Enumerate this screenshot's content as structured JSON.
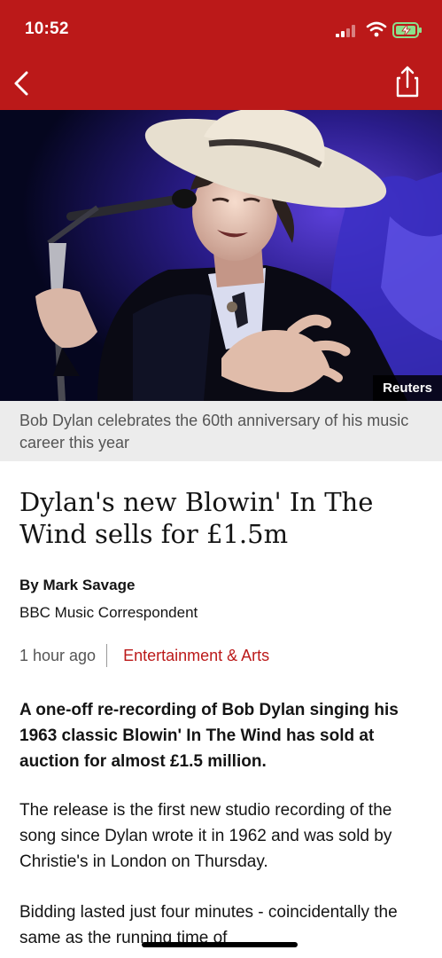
{
  "status_bar": {
    "time": "10:52",
    "signal_icon": "signal-icon",
    "wifi_icon": "wifi-icon",
    "battery_icon": "battery-charging-icon"
  },
  "header": {
    "back_icon": "chevron-left-icon",
    "share_icon": "share-icon",
    "background_color": "#bb1919"
  },
  "hero": {
    "credit": "Reuters",
    "caption": "Bob Dylan celebrates the 60th anniversary of his music career this year"
  },
  "article": {
    "headline": "Dylan's new Blowin' In The Wind sells for £1.5m",
    "author": "By Mark Savage",
    "role": "BBC Music Correspondent",
    "time": "1 hour ago",
    "topic": "Entertainment & Arts",
    "lead": "A one-off re-recording of Bob Dylan singing his 1963 classic Blowin' In The Wind has sold at auction for almost £1.5 million.",
    "paragraph_2": "The release is the first new studio recording of the song since Dylan wrote it in 1962 and was sold by Christie's in London on Thursday.",
    "paragraph_3": "Bidding lasted just four minutes - coincidentally the same as the running time of"
  },
  "colors": {
    "accent": "#bb1919",
    "caption_bg": "#ececec",
    "text": "#141414",
    "muted": "#555555"
  }
}
